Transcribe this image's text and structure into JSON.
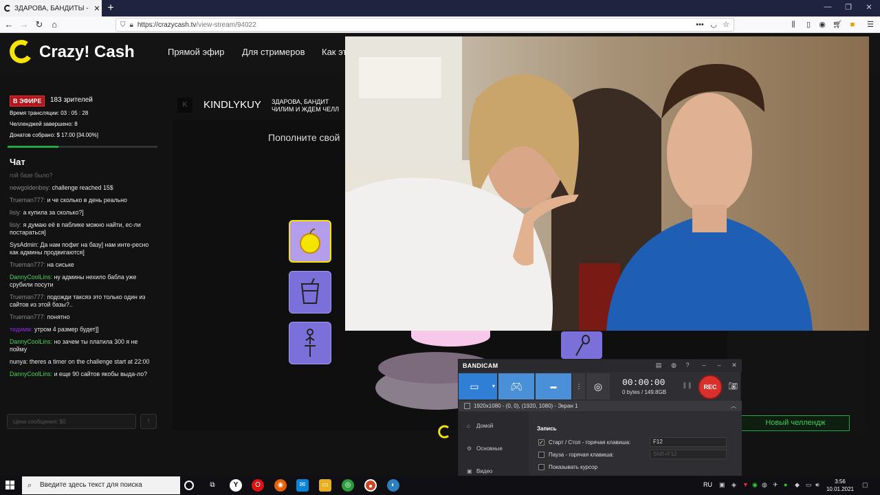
{
  "browser": {
    "tab_title": "ЗДАРОВА, БАНДИТЫ - Cra",
    "url_main": "https://crazycash.tv",
    "url_path": "/view-stream/94022",
    "new_tab_symbol": "+"
  },
  "site": {
    "logo_text": "Crazy! Cash",
    "nav": [
      "Прямой эфир",
      "Для стримеров",
      "Как эт"
    ],
    "live_badge": "В ЭФИРЕ",
    "viewers": "183 зрителей",
    "stats": [
      "Время трансляции: 03 : 05 : 28",
      "Челленджей завершено: 8",
      "Донатов собрано: $ 17.00 [34.00%]"
    ],
    "progress_fraction": 0.34,
    "chat_title": "Чат",
    "chat_messages": [
      {
        "user": "",
        "text": "гой базе было?",
        "user_color": "gray",
        "text_dim": true
      },
      {
        "user": "newgoldenboy:",
        "text": "challenge reached 15$",
        "user_color": "gray"
      },
      {
        "user": "Trueman777:",
        "text": "и че сколько в день реально",
        "user_color": "gray"
      },
      {
        "user": "lisiy:",
        "text": "а купила за сколько?]",
        "user_color": "gray"
      },
      {
        "user": "lisiy:",
        "text": "я думаю её в паблике можно найти, ес-ли постараться]",
        "user_color": "gray"
      },
      {
        "user": "SysAdmin:",
        "text": "Да нам пофиг на базу] нам инте-ресно как админы продвигаются]",
        "user_color": "plain"
      },
      {
        "user": "Trueman777:",
        "text": "на сиське",
        "user_color": "gray"
      },
      {
        "user": "DannyCoolLins:",
        "text": "ну админы нехило бабла уже срубили посути",
        "user_color": "green"
      },
      {
        "user": "Trueman777:",
        "text": "подожди таксяэ это только один из сайтов из этой базы?..",
        "user_color": "gray"
      },
      {
        "user": "Trueman777:",
        "text": "понятно",
        "user_color": "gray"
      },
      {
        "user": "тидимм:",
        "text": "утром 4 размер будет]]",
        "user_color": "purple"
      },
      {
        "user": "DannyCoolLins:",
        "text": "но зачем ты платила 300 я не пойму",
        "user_color": "green"
      },
      {
        "user": "nunya:",
        "text": "theres a timer on the challenge start at 22:00",
        "user_color": "plain"
      },
      {
        "user": "DannyCoolLins:",
        "text": "и еще 90 сайтов якобы выда-ло?",
        "user_color": "green"
      }
    ],
    "chat_placeholder": "Цена сообщения: $0",
    "send_symbol": "↑",
    "avatar_letter": "K",
    "streamer_name": "KINDLYKUY",
    "stream_title_1": "ЗДАРОВА, БАНДИТ",
    "stream_title_2": "ЧИЛИМ И ЖДЕМ ЧЕЛЛ",
    "topup_text": "Пополните свой",
    "new_challenge": "Новый челлендж"
  },
  "bandicam": {
    "logo": "BANDICAM",
    "time": "00:00:00",
    "size": "0 bytes / 149.8GB",
    "rec_label": "REC",
    "resolution": "1920x1080 - (0, 0), (1920, 1080) - Экран 1",
    "side_items": [
      {
        "icon": "home-icon",
        "label": "Домой"
      },
      {
        "icon": "gear-icon",
        "label": "Основные"
      },
      {
        "icon": "video-icon",
        "label": "Видео"
      }
    ],
    "section_title": "Запись",
    "rows": [
      {
        "label": "Старт / Стоп - горячая клавиша:",
        "checked": true,
        "value": "F12"
      },
      {
        "label": "Пауза - горячая клавиша:",
        "checked": false,
        "value": "Shift+F12"
      },
      {
        "label": "Показывать курсор",
        "checked": false,
        "value": ""
      }
    ]
  },
  "taskbar": {
    "search_placeholder": "Введите здесь текст для поиска",
    "language": "RU",
    "time": "3:56",
    "date": "10.01.2021"
  },
  "colors": {
    "brand_yellow": "#f5e400",
    "live_red": "#b4151b",
    "accent_green": "#1fa84a",
    "gift_purple": "#7b6fd9",
    "bandicam_blue": "#4a90d8",
    "rec_red": "#d9302b"
  }
}
